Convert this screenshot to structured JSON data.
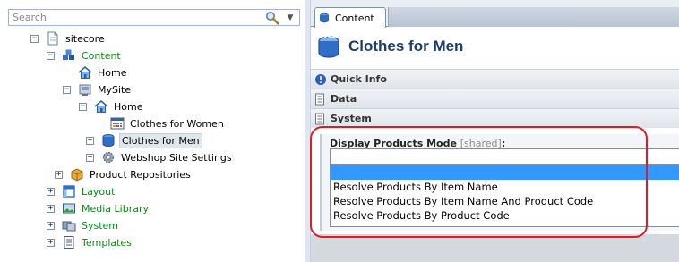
{
  "search": {
    "placeholder": "Search"
  },
  "tree": {
    "items": [
      {
        "label": "sitecore"
      },
      {
        "label": "Content"
      },
      {
        "label": "Home"
      },
      {
        "label": "MySite"
      },
      {
        "label": "Home"
      },
      {
        "label": "Clothes for Women"
      },
      {
        "label": "Clothes for Men"
      },
      {
        "label": "Webshop Site Settings"
      },
      {
        "label": "Product Repositories"
      },
      {
        "label": "Layout"
      },
      {
        "label": "Media Library"
      },
      {
        "label": "System"
      },
      {
        "label": "Templates"
      }
    ]
  },
  "editor": {
    "tab_label": "Content",
    "title": "Clothes for Men",
    "sections": [
      {
        "title": "Quick Info"
      },
      {
        "title": "Data"
      },
      {
        "title": "System"
      }
    ],
    "field": {
      "label": "Display Products Mode",
      "shared": "[shared]",
      "colon": ":",
      "selected_value": "",
      "options": [
        "",
        "Resolve Products By Item Name",
        "Resolve Products By Item Name And Product Code",
        "Resolve Products By Product Code"
      ]
    }
  },
  "colors": {
    "green_text": "#0a8a17",
    "title_blue": "#1d3e6d",
    "option_highlight": "#3399ff",
    "annotation_red": "#e01b24"
  }
}
